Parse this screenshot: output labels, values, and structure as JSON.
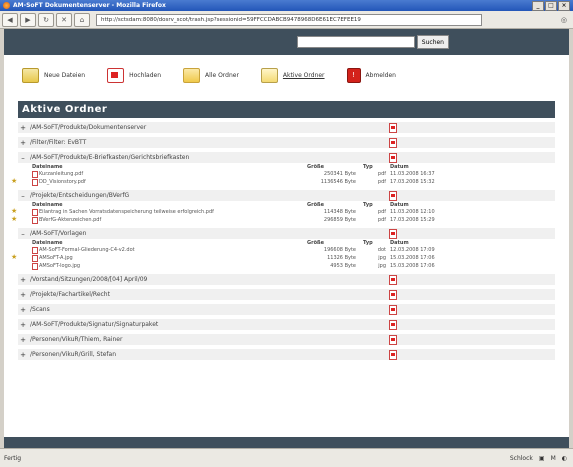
{
  "window": {
    "title": "AM-SoFT Dokumentenserver - Mozilla Firefox"
  },
  "browser": {
    "url": "http://sctsdam:8080/dosrv_scot/trash.jsp?sessionid=59FFCCDABCB9478968D6E61EC7EFEE19"
  },
  "search": {
    "placeholder": "",
    "button": "Suchen"
  },
  "toolbar": {
    "new_docs": "Neue Dateien",
    "upload": "Hochladen",
    "all_folders": "Alle Ordner",
    "active_folders": "Aktive Ordner",
    "logout": "Abmelden"
  },
  "section_title": "Aktive Ordner",
  "file_columns": {
    "name": "Dateiname",
    "size": "Größe",
    "type": "Typ",
    "date": "Datum"
  },
  "folders": [
    {
      "toggle": "+",
      "name": "/AM-SoFT/Produkte/Dokumentenserver"
    },
    {
      "toggle": "+",
      "name": "/Filter/Filter: EvBTT"
    },
    {
      "toggle": "–",
      "name": "/AM-SoFT/Produkte/E-Briefkasten/Gerichtsbriefkasten"
    },
    {
      "toggle": "–",
      "name": "/Projekte/Entscheidungen/BVerfG"
    },
    {
      "toggle": "–",
      "name": "/AM-SoFT/Vorlagen"
    },
    {
      "toggle": "+",
      "name": "/Vorstand/Sitzungen/2008/[04] April/09"
    },
    {
      "toggle": "+",
      "name": "/Projekte/Fachartikel/Recht"
    },
    {
      "toggle": "+",
      "name": "/Scans"
    },
    {
      "toggle": "+",
      "name": "/AM-SoFT/Produkte/Signatur/Signaturpaket"
    },
    {
      "toggle": "+",
      "name": "/Personen/VikuR/Thiem, Rainer"
    },
    {
      "toggle": "+",
      "name": "/Personen/VikuR/Grill, Stefan"
    }
  ],
  "files_briefkasten": [
    {
      "name": "Kurzanleitung.pdf",
      "size": "250341 Byte",
      "type": "pdf",
      "date": "11.03.2008 16:37"
    },
    {
      "name": "DD_Visionstory.pdf",
      "size": "1136546 Byte",
      "type": "pdf",
      "date": "17.03.2008 15:32"
    }
  ],
  "files_bverfg": [
    {
      "name": "Eilantrag in Sachen Vorratsdatenspeicherung teilweise erfolgreich.pdf",
      "size": "114348 Byte",
      "type": "pdf",
      "date": "11.03.2008 12:10"
    },
    {
      "name": "BVerfG-Aktenzeichen.pdf",
      "size": "296859 Byte",
      "type": "pdf",
      "date": "17.03.2008 15:29"
    }
  ],
  "files_vorlagen": [
    {
      "name": "AM-SoFT-Formal-Gliederung-C4-v2.dot",
      "size": "196608 Byte",
      "type": "dot",
      "date": "12.03.2008 17:09"
    },
    {
      "name": "AMSoFT-A.jpg",
      "size": "11326 Byte",
      "type": "jpg",
      "date": "15.03.2008 17:06"
    },
    {
      "name": "AMSoFT-logo.jpg",
      "size": "4953 Byte",
      "type": "jpg",
      "date": "15.03.2008 17:06"
    }
  ],
  "status": {
    "left": "Fertig",
    "right": "Schlock"
  }
}
